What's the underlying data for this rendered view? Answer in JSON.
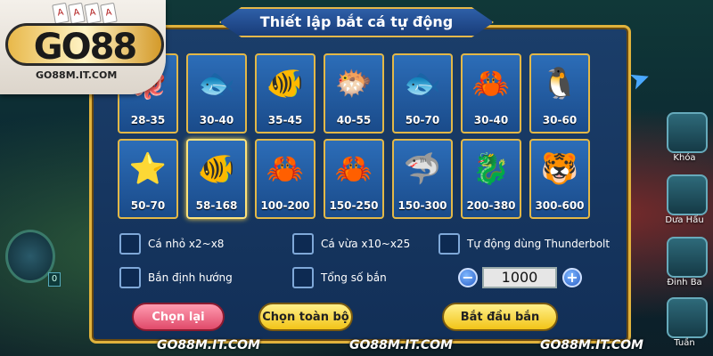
{
  "logo": {
    "wordmark": "GO88",
    "url": "GO88M.IT.COM",
    "cards": [
      "A",
      "A",
      "A",
      "A"
    ]
  },
  "panel": {
    "title": "Thiết lập bắt cá tự động"
  },
  "fish": [
    {
      "range": "28-35",
      "icon": "octopus-icon",
      "glyph": "🐙"
    },
    {
      "range": "30-40",
      "icon": "manta-ray-icon",
      "glyph": "🐟"
    },
    {
      "range": "35-45",
      "icon": "clownfish-icon",
      "glyph": "🐠"
    },
    {
      "range": "40-55",
      "icon": "pufferfish-icon",
      "glyph": "🐡"
    },
    {
      "range": "50-70",
      "icon": "goldfish-icon",
      "glyph": "🐟"
    },
    {
      "range": "30-40",
      "icon": "crab-icon",
      "glyph": "🦀"
    },
    {
      "range": "30-60",
      "icon": "penguin-icon",
      "glyph": "🐧"
    },
    {
      "range": "50-70",
      "icon": "starfish-icon",
      "glyph": "⭐"
    },
    {
      "range": "58-168",
      "icon": "golden-fish-icon",
      "glyph": "🐠"
    },
    {
      "range": "100-200",
      "icon": "hermit-crab-icon",
      "glyph": "🦀"
    },
    {
      "range": "150-250",
      "icon": "red-crab-icon",
      "glyph": "🦀"
    },
    {
      "range": "150-300",
      "icon": "shark-icon",
      "glyph": "🦈"
    },
    {
      "range": "200-380",
      "icon": "golden-dragon-icon",
      "glyph": "🐉"
    },
    {
      "range": "300-600",
      "icon": "tiger-icon",
      "glyph": "🐯"
    }
  ],
  "options": {
    "small_fish": "Cá nhỏ x2~x8",
    "medium_fish": "Cá vừa x10~x25",
    "thunderbolt": "Tự động dùng Thunderbolt",
    "directional": "Bắn định hướng",
    "total_shots": "Tổng số bắn"
  },
  "stepper": {
    "value": "1000",
    "minus": "−",
    "plus": "+"
  },
  "buttons": {
    "reselect": "Chọn lại",
    "select_all": "Chọn toàn bộ",
    "start": "Bắt đầu bắn"
  },
  "side": {
    "lock": "Khóa",
    "watermelon": "Dưa Hấu",
    "nail": "Đinh Ba",
    "last": "Tuần"
  },
  "gauge_count": "0",
  "watermark": [
    "GO88M.IT.COM",
    "GO88M.IT.COM",
    "GO88M.IT.COM"
  ]
}
